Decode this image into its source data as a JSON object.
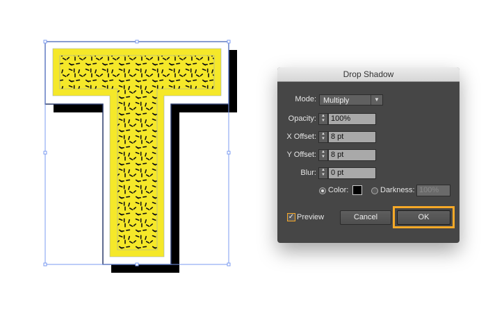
{
  "artwork": {
    "letter": "T",
    "fill_color": "#f5e829",
    "shadow_color": "#000000",
    "selection_color": "#7b9bf0"
  },
  "dialog": {
    "title": "Drop Shadow",
    "mode": {
      "label": "Mode:",
      "value": "Multiply"
    },
    "opacity": {
      "label": "Opacity:",
      "value": "100%"
    },
    "x_offset": {
      "label": "X Offset:",
      "value": "8 pt"
    },
    "y_offset": {
      "label": "Y Offset:",
      "value": "8 pt"
    },
    "blur": {
      "label": "Blur:",
      "value": "0 pt"
    },
    "color": {
      "label": "Color:",
      "selected": true,
      "swatch": "#000000"
    },
    "darkness": {
      "label": "Darkness:",
      "value": "100%",
      "selected": false
    },
    "preview": {
      "label": "Preview",
      "checked": true
    },
    "cancel_label": "Cancel",
    "ok_label": "OK",
    "highlight_color": "#f7a928"
  }
}
